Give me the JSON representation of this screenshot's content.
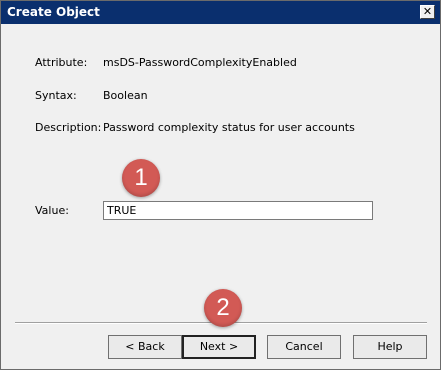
{
  "window": {
    "title": "Create Object"
  },
  "fields": {
    "attribute_label": "Attribute:",
    "attribute_value": "msDS-PasswordComplexityEnabled",
    "syntax_label": "Syntax:",
    "syntax_value": "Boolean",
    "description_label": "Description:",
    "description_value": "Password complexity status for user accounts",
    "value_label": "Value:",
    "value_input": "TRUE"
  },
  "buttons": {
    "back": "< Back",
    "next": "Next >",
    "cancel": "Cancel",
    "help": "Help"
  },
  "annotations": {
    "step1": "1",
    "step2": "2"
  },
  "colors": {
    "title_bar": "#0a2f6e",
    "marker": "#d25a55"
  }
}
